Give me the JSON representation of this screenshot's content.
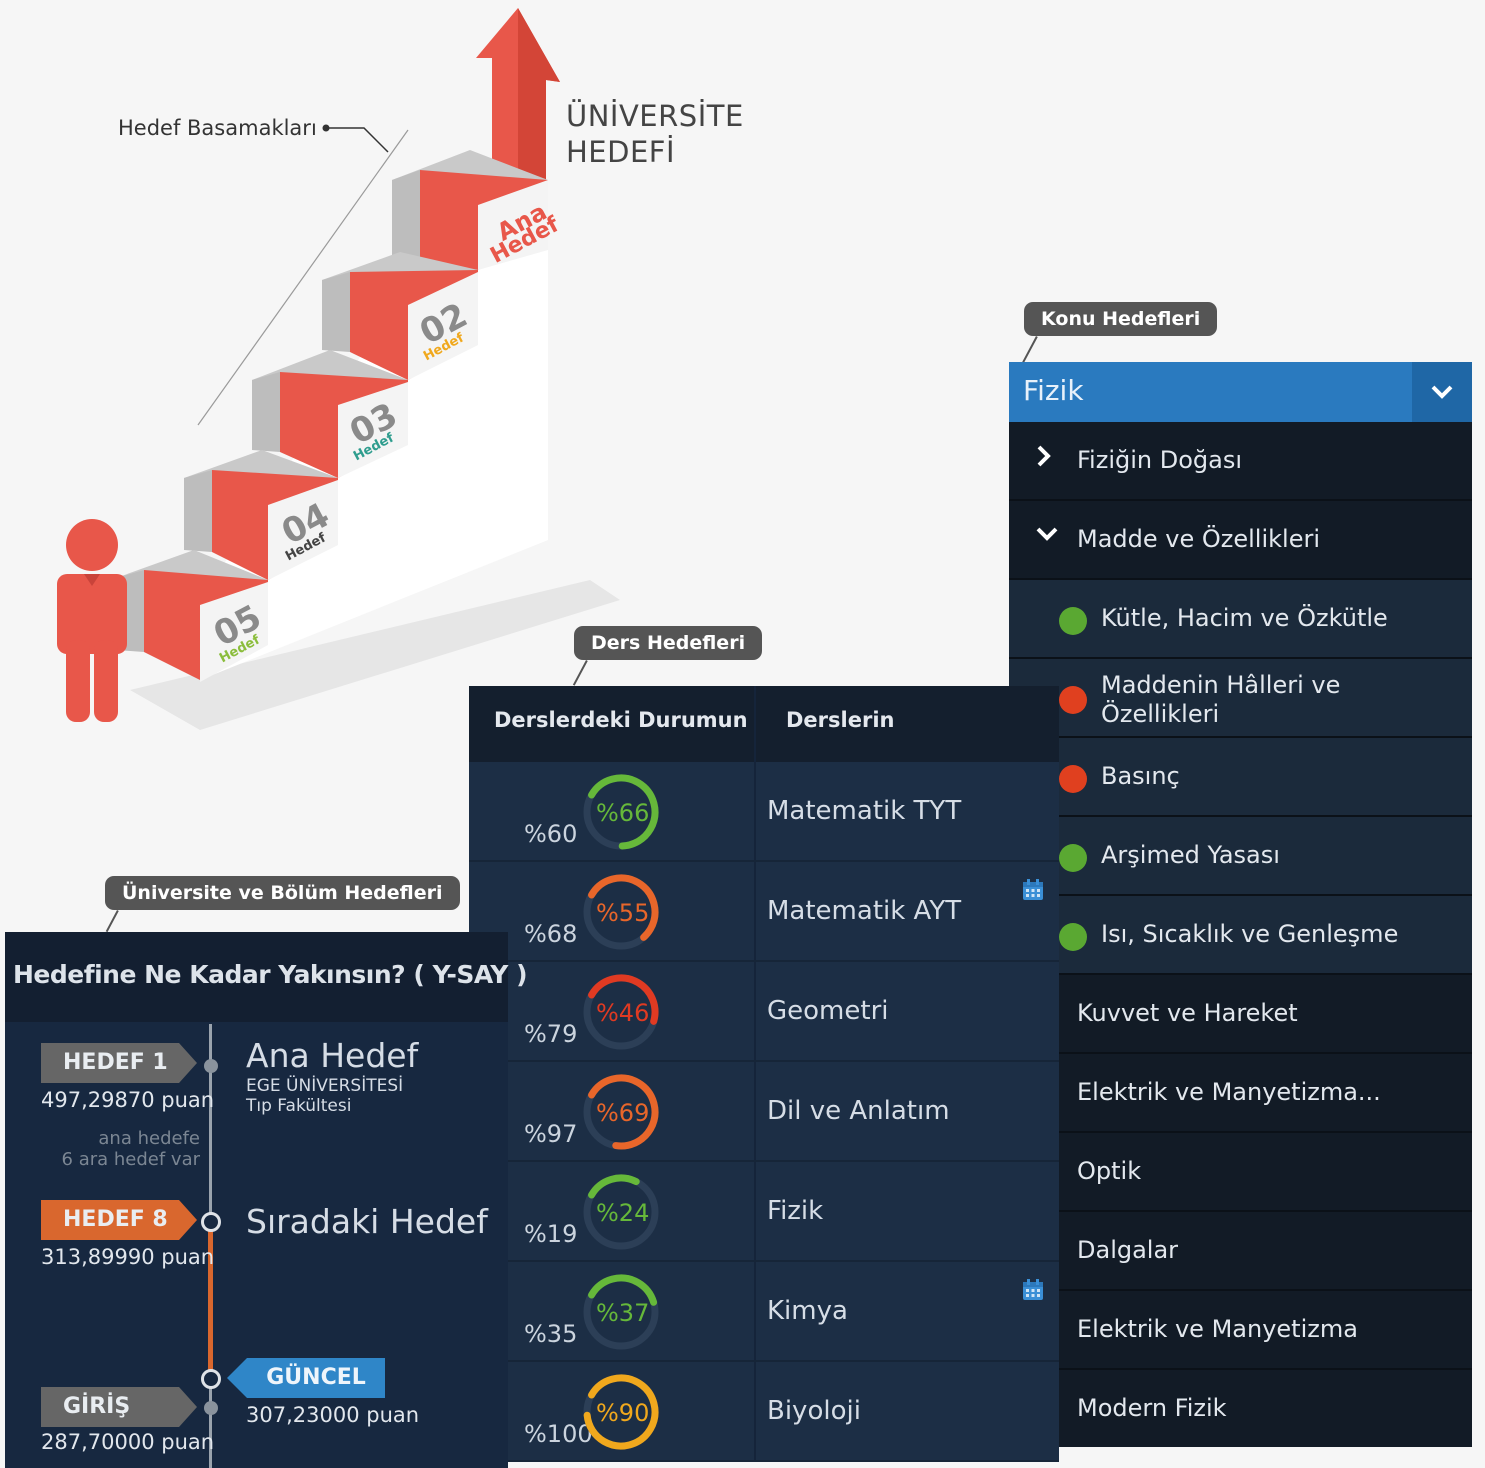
{
  "stairs": {
    "caption": "Hedef Basamakları",
    "goal_title_line1": "ÜNİVERSİTE",
    "goal_title_line2": "HEDEFİ",
    "steps": [
      {
        "num": "Ana",
        "sub": "Hedef"
      },
      {
        "num": "02",
        "sub": "Hedef"
      },
      {
        "num": "03",
        "sub": "Hedef"
      },
      {
        "num": "04",
        "sub": "Hedef"
      },
      {
        "num": "05",
        "sub": "Hedef"
      }
    ]
  },
  "tags": {
    "konu": "Konu Hedefleri",
    "ders": "Ders Hedefleri",
    "uni": "Üniversite ve Bölüm Hedefleri"
  },
  "konu": {
    "subject": "Fizik",
    "topics": [
      {
        "label": "Fiziğin Doğası",
        "state": "collapsed"
      },
      {
        "label": "Madde ve Özellikleri",
        "state": "expanded"
      }
    ],
    "subtopics": [
      {
        "label": "Kütle, Hacim ve Özkütle",
        "status_color": "#5aa832"
      },
      {
        "label_line1": "Maddenin Hâlleri ve",
        "label_line2": "Özellikleri",
        "status_color": "#e0401f"
      },
      {
        "label": "Basınç",
        "status_color": "#e0401f"
      },
      {
        "label": "Arşimed Yasası",
        "status_color": "#5aa832"
      },
      {
        "label": "Isı, Sıcaklık ve Genleşme",
        "status_color": "#5aa832"
      }
    ],
    "more_topics": [
      "Kuvvet ve Hareket",
      "Elektrik ve Manyetizma...",
      "Optik",
      "Dalgalar",
      "Elektrik ve Manyetizma",
      "Modern Fizik"
    ]
  },
  "ders": {
    "col_status": "Derslerdeki Durumun",
    "col_courses": "Derslerin",
    "rows": [
      {
        "current": "%60",
        "target": "%66",
        "target_value": 66,
        "color": "#66b83a",
        "course": "Matematik TYT",
        "calendar": false
      },
      {
        "current": "%68",
        "target": "%55",
        "target_value": 55,
        "color": "#e8662a",
        "course": "Matematik AYT",
        "calendar": true
      },
      {
        "current": "%79",
        "target": "%46",
        "target_value": 46,
        "color": "#e03a22",
        "course": "Geometri",
        "calendar": false
      },
      {
        "current": "%97",
        "target": "%69",
        "target_value": 69,
        "color": "#e8662a",
        "course": "Dil ve Anlatım",
        "calendar": false
      },
      {
        "current": "%19",
        "target": "%24",
        "target_value": 24,
        "color": "#66b83a",
        "course": "Fizik",
        "calendar": false
      },
      {
        "current": "%35",
        "target": "%37",
        "target_value": 37,
        "color": "#66b83a",
        "course": "Kimya",
        "calendar": true
      },
      {
        "current": "%100",
        "target": "%90",
        "target_value": 90,
        "color": "#f0a81d",
        "course": "Biyoloji",
        "calendar": false
      }
    ]
  },
  "uni": {
    "title": "Hedefine Ne Kadar Yakınsın? ( Y-SAY )",
    "hedef1": {
      "flag": "HEDEF 1",
      "points": "497,29870 puan",
      "title": "Ana Hedef",
      "line1": "EGE ÜNİVERSİTESİ",
      "line2": "Tıp Fakültesi"
    },
    "note_line1": "ana hedefe",
    "note_line2": "6 ara hedef var",
    "hedef8": {
      "flag": "HEDEF 8",
      "points": "313,89990 puan",
      "title": "Sıradaki Hedef"
    },
    "guncel": {
      "flag": "GÜNCEL",
      "points": "307,23000 puan"
    },
    "giris": {
      "flag": "GİRİŞ",
      "points": "287,70000 puan"
    }
  }
}
